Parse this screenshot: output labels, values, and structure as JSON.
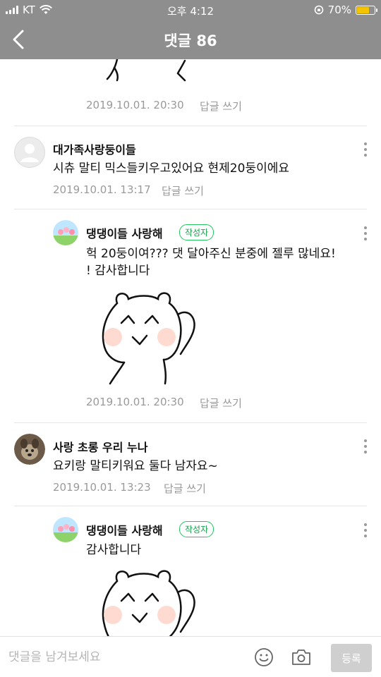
{
  "status_bar": {
    "carrier": "KT",
    "time": "오후 4:12",
    "battery_percent": "70%",
    "battery_level": 0.7
  },
  "header": {
    "title": "댓글 86"
  },
  "comments": [
    {
      "date": "2019.10.01. 20:30",
      "reply_label": "답글 쓰기"
    },
    {
      "author": "대가족사랑둥이들",
      "text": "시츄 말티 믹스들키우고있어요 현제20둥이에요",
      "date": "2019.10.01. 13:17",
      "reply_label": "답글 쓰기",
      "replies": [
        {
          "author": "댕댕이들 사랑해",
          "badge": "작성자",
          "text_line1": "헉 20둥이여??? 댓 달아주신 분중에 젤루 많네요!",
          "text_line2": "! 감사합니다",
          "date": "2019.10.01. 20:30",
          "reply_label": "답글 쓰기"
        }
      ]
    },
    {
      "author": "사랑 초롱 우리 누나",
      "text": "요키랑 말티키워요 둘다 남자요~",
      "date": "2019.10.01. 13:23",
      "reply_label": "답글 쓰기",
      "replies": [
        {
          "author": "댕댕이들 사랑해",
          "badge": "작성자",
          "text": "감사합니다"
        }
      ]
    }
  ],
  "input_bar": {
    "placeholder": "댓글을 남겨보세요",
    "submit_label": "등록"
  },
  "colors": {
    "header_bg": "#8e8e8e",
    "badge_green": "#22c55e",
    "meta_gray": "#9a9a9a",
    "battery_yellow": "#f5c400"
  }
}
